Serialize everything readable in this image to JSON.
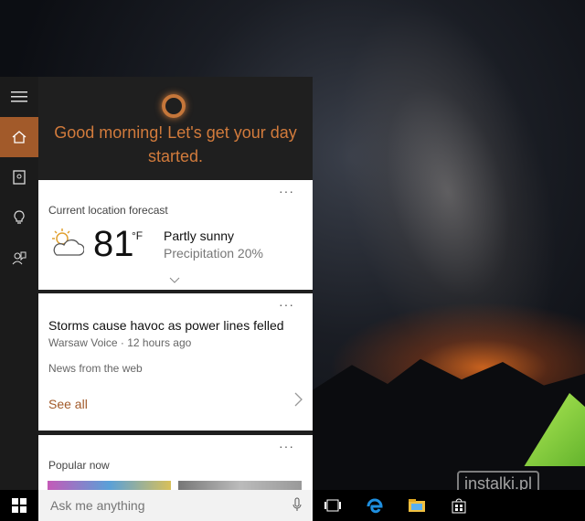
{
  "cortana": {
    "greeting": "Good morning! Let's get your day started."
  },
  "rail": {
    "items": [
      {
        "name": "menu",
        "icon": "hamburger-icon"
      },
      {
        "name": "home",
        "icon": "home-icon"
      },
      {
        "name": "notebook",
        "icon": "notebook-icon"
      },
      {
        "name": "reminders",
        "icon": "lightbulb-icon"
      },
      {
        "name": "feedback",
        "icon": "feedback-icon"
      }
    ],
    "accent": "#a25a2a"
  },
  "weather_card": {
    "title": "Current location forecast",
    "temp": "81",
    "unit": "°F",
    "condition": "Partly sunny",
    "precip": "Precipitation 20%",
    "more": "···"
  },
  "news_card": {
    "headline": "Storms cause havoc as power lines felled",
    "source": "Warsaw Voice · 12 hours ago",
    "section": "News from the web",
    "see_all": "See all",
    "more": "···"
  },
  "popular_card": {
    "title": "Popular now",
    "more": "···"
  },
  "taskbar": {
    "search_placeholder": "Ask me anything"
  },
  "watermark": "instalki.pl"
}
